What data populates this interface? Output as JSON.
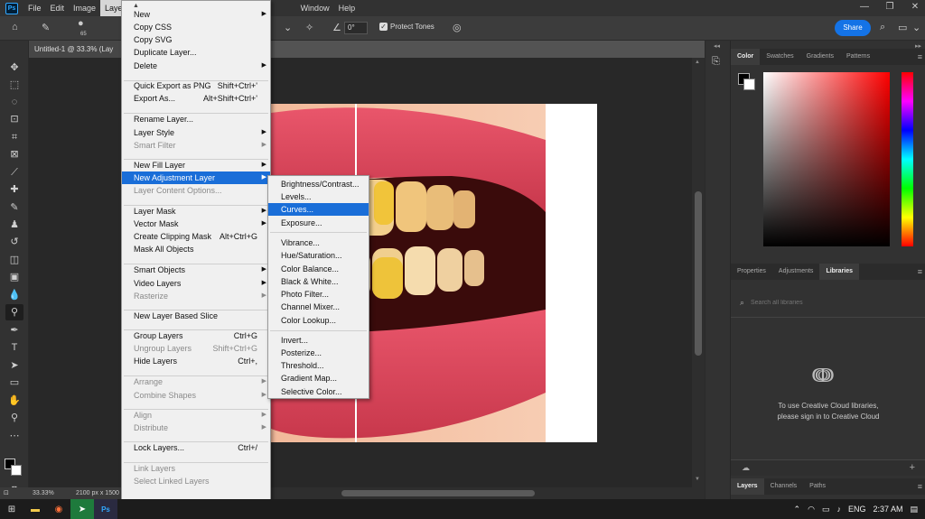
{
  "app": {
    "logo": "Ps"
  },
  "menubar": {
    "items": [
      "File",
      "Edit",
      "Image",
      "Layer",
      "Window",
      "Help"
    ],
    "active": "Layer"
  },
  "window_controls": {
    "minimize": "—",
    "restore": "❐",
    "close": "✕"
  },
  "options_bar": {
    "brush_size": "65",
    "angle_value": "0°",
    "protect_tones_label": "Protect Tones",
    "share_label": "Share"
  },
  "document": {
    "tab_title": "Untitled-1 @ 33.3% (Lay",
    "zoom": "33.33%",
    "dimensions": "2100 px x 1500"
  },
  "layer_menu": [
    {
      "label": "New",
      "arrow": true
    },
    {
      "label": "Copy CSS"
    },
    {
      "label": "Copy SVG"
    },
    {
      "label": "Duplicate Layer..."
    },
    {
      "label": "Delete",
      "arrow": true
    },
    {
      "label": "Quick Export as PNG",
      "shortcut": "Shift+Ctrl+'"
    },
    {
      "label": "Export As...",
      "shortcut": "Alt+Shift+Ctrl+'"
    },
    {
      "label": "Rename Layer..."
    },
    {
      "label": "Layer Style",
      "arrow": true
    },
    {
      "label": "Smart Filter",
      "arrow": true,
      "disabled": true
    },
    {
      "label": "New Fill Layer",
      "arrow": true
    },
    {
      "label": "New Adjustment Layer",
      "arrow": true,
      "highlight": true
    },
    {
      "label": "Layer Content Options...",
      "disabled": true
    },
    {
      "label": "Layer Mask",
      "arrow": true
    },
    {
      "label": "Vector Mask",
      "arrow": true
    },
    {
      "label": "Create Clipping Mask",
      "shortcut": "Alt+Ctrl+G"
    },
    {
      "label": "Mask All Objects"
    },
    {
      "label": "Smart Objects",
      "arrow": true
    },
    {
      "label": "Video Layers",
      "arrow": true
    },
    {
      "label": "Rasterize",
      "arrow": true,
      "disabled": true
    },
    {
      "label": "New Layer Based Slice"
    },
    {
      "label": "Group Layers",
      "shortcut": "Ctrl+G"
    },
    {
      "label": "Ungroup Layers",
      "shortcut": "Shift+Ctrl+G",
      "disabled": true
    },
    {
      "label": "Hide Layers",
      "shortcut": "Ctrl+,"
    },
    {
      "label": "Arrange",
      "arrow": true,
      "disabled": true
    },
    {
      "label": "Combine Shapes",
      "arrow": true,
      "disabled": true
    },
    {
      "label": "Align",
      "arrow": true,
      "disabled": true
    },
    {
      "label": "Distribute",
      "arrow": true,
      "disabled": true
    },
    {
      "label": "Lock Layers...",
      "shortcut": "Ctrl+/"
    },
    {
      "label": "Link Layers",
      "disabled": true
    },
    {
      "label": "Select Linked Layers",
      "disabled": true
    }
  ],
  "adjustment_submenu": [
    {
      "label": "Brightness/Contrast..."
    },
    {
      "label": "Levels..."
    },
    {
      "label": "Curves...",
      "highlight": true
    },
    {
      "label": "Exposure..."
    },
    {
      "label": "Vibrance..."
    },
    {
      "label": "Hue/Saturation..."
    },
    {
      "label": "Color Balance..."
    },
    {
      "label": "Black & White..."
    },
    {
      "label": "Photo Filter..."
    },
    {
      "label": "Channel Mixer..."
    },
    {
      "label": "Color Lookup..."
    },
    {
      "label": "Invert..."
    },
    {
      "label": "Posterize..."
    },
    {
      "label": "Threshold..."
    },
    {
      "label": "Gradient Map..."
    },
    {
      "label": "Selective Color..."
    }
  ],
  "color_panel": {
    "tabs": [
      "Color",
      "Swatches",
      "Gradients",
      "Patterns"
    ],
    "active": "Color",
    "hue_color": "#ff0000"
  },
  "libraries_panel": {
    "tabs": [
      "Properties",
      "Adjustments",
      "Libraries"
    ],
    "active": "Libraries",
    "search_placeholder": "Search all libraries",
    "message_line1": "To use Creative Cloud libraries,",
    "message_line2": "please sign in to Creative Cloud"
  },
  "layers_panel": {
    "tabs": [
      "Layers",
      "Channels",
      "Paths"
    ],
    "active": "Layers"
  },
  "taskbar": {
    "time": "2:37 AM",
    "lang": "ENG"
  }
}
